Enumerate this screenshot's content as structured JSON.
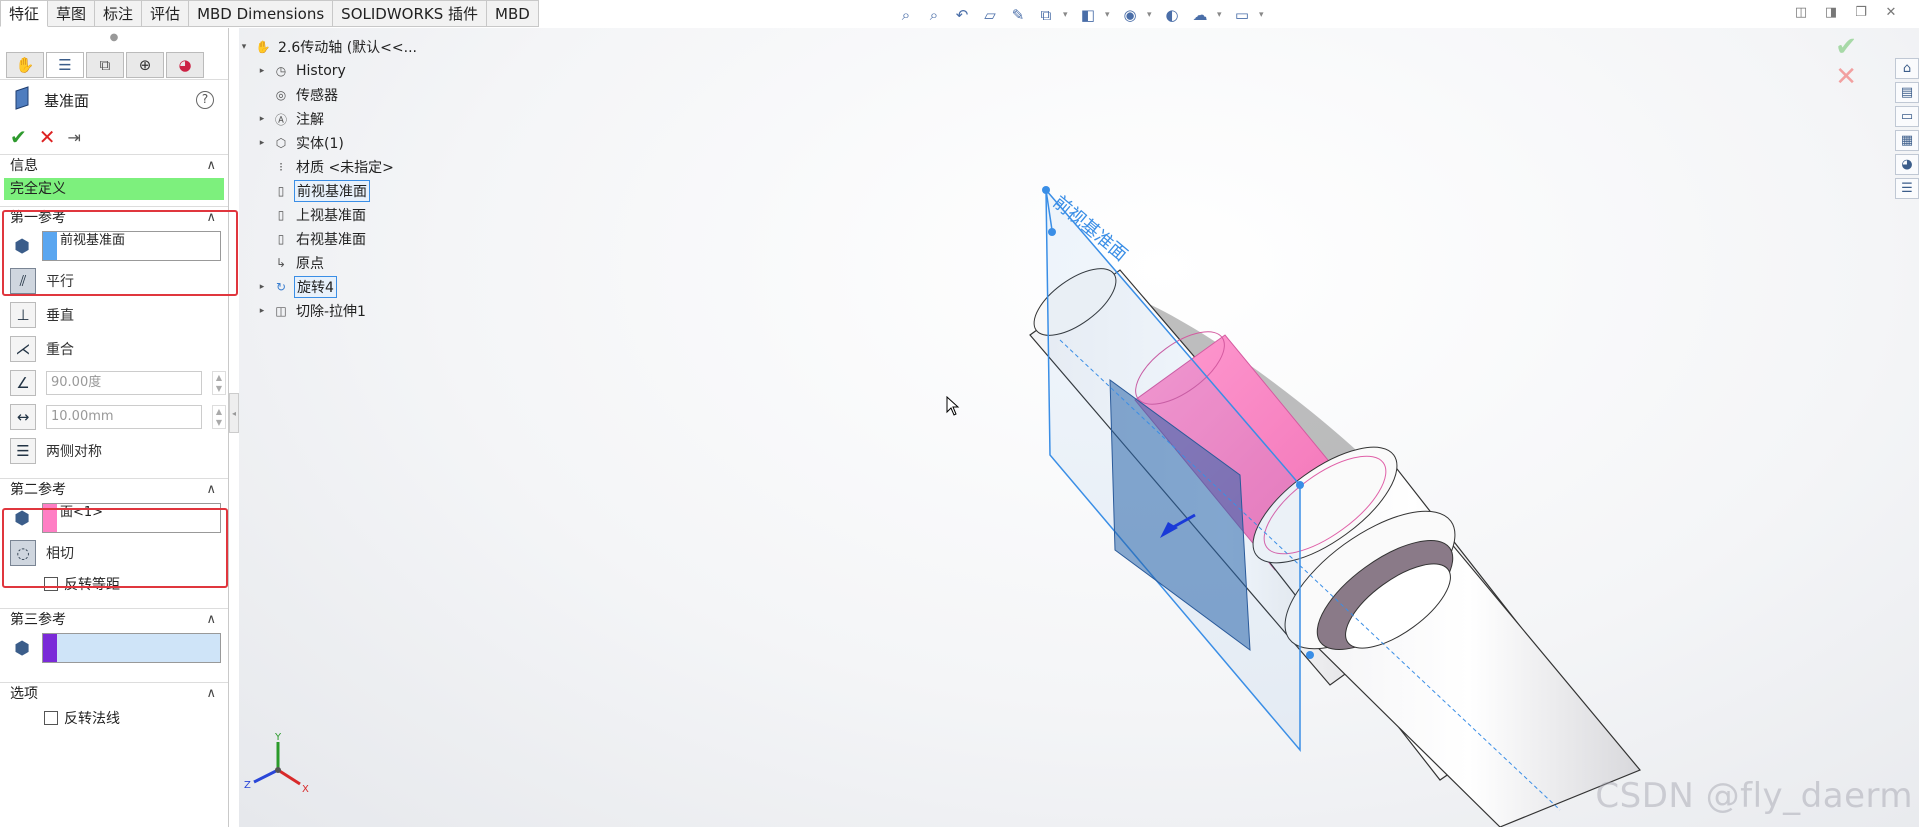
{
  "command_tabs": [
    "特征",
    "草图",
    "标注",
    "评估",
    "MBD Dimensions",
    "SOLIDWORKS 插件",
    "MBD"
  ],
  "feature": {
    "name": "基准面",
    "help_glyph": "?"
  },
  "sections": {
    "info": {
      "title": "信息",
      "status": "完全定义",
      "status_color": "#7df07d"
    },
    "first_ref": {
      "title": "第一参考",
      "value": "前视基准面",
      "swatch_color": "#5aa6f0",
      "options": [
        "平行",
        "垂直",
        "重合"
      ],
      "angle": "90.00度",
      "distance": "10.00mm",
      "symmetric": "两侧对称"
    },
    "second_ref": {
      "title": "第二参考",
      "value": "面<1>",
      "swatch_color": "#ff7ec4",
      "tangent": "相切",
      "flip_offset": "反转等距"
    },
    "third_ref": {
      "title": "第三参考",
      "value": "",
      "swatch_color": "#7a2ad8"
    },
    "options": {
      "title": "选项",
      "flip_normal": "反转法线"
    }
  },
  "tree": {
    "root": "2.6传动轴 (默认<<...",
    "items": [
      {
        "label": "History",
        "arrow": true
      },
      {
        "label": "传感器",
        "arrow": false
      },
      {
        "label": "注解",
        "arrow": true
      },
      {
        "label": "实体(1)",
        "arrow": true
      },
      {
        "label": "材质 <未指定>",
        "arrow": false
      },
      {
        "label": "前视基准面",
        "arrow": false,
        "selected": true
      },
      {
        "label": "上视基准面",
        "arrow": false
      },
      {
        "label": "右视基准面",
        "arrow": false
      },
      {
        "label": "原点",
        "arrow": false
      },
      {
        "label": "旋转4",
        "arrow": true,
        "selected": true
      },
      {
        "label": "切除-拉伸1",
        "arrow": true
      }
    ]
  },
  "viewport": {
    "plane_label": "前视基准面",
    "triad_axes": [
      "Y",
      "Z",
      "X"
    ]
  },
  "watermark": "CSDN @fly_daerm"
}
